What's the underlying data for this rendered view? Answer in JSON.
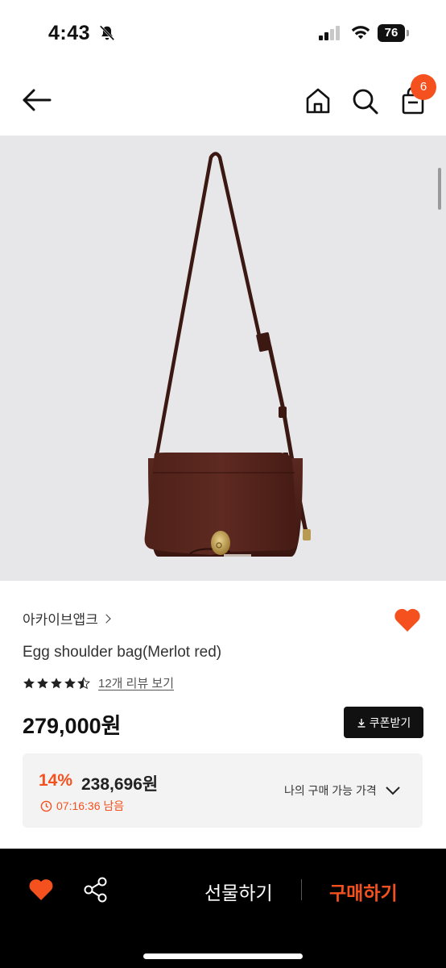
{
  "status_bar": {
    "time": "4:43",
    "battery": "76"
  },
  "nav": {
    "cart_count": "6"
  },
  "product": {
    "brand": "아카이브앱크",
    "title": "Egg shoulder bag(Merlot red)",
    "rating": 4.5,
    "review_link": "12개 리뷰 보기",
    "price": "279,000원",
    "coupon_label": "쿠폰받기"
  },
  "discount": {
    "rate": "14%",
    "price": "238,696원",
    "timer": "07:16:36 남음",
    "my_price_label": "나의 구매 가능 가격"
  },
  "bottom_bar": {
    "gift_label": "선물하기",
    "buy_label": "구매하기"
  },
  "colors": {
    "accent": "#f4511e",
    "bag": "#4a1e17",
    "image_background": "#e7e7e9"
  }
}
